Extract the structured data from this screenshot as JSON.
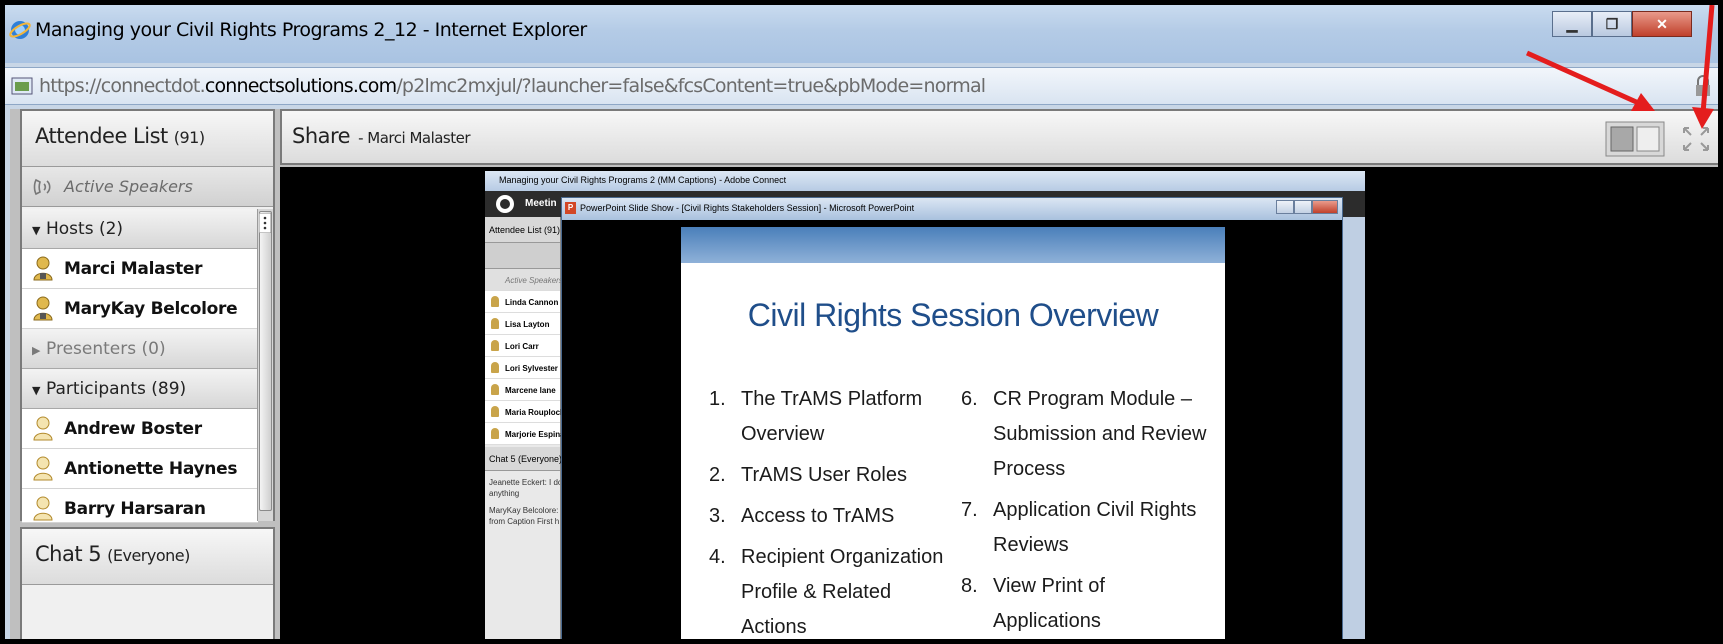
{
  "window": {
    "title": "Managing your Civil Rights Programs 2_12 - Internet Explorer",
    "url_prefix": "https://connectdot.",
    "url_domain": "connectsolutions.com",
    "url_rest": "/p2lmc2mxjul/?launcher=false&fcsContent=true&pbMode=normal"
  },
  "attendee_pod": {
    "title": "Attendee List",
    "count": "(91)",
    "active_speakers": "Active Speakers",
    "groups": {
      "hosts": "Hosts (2)",
      "presenters": "Presenters (0)",
      "participants": "Participants (89)"
    },
    "hosts": [
      "Marci Malaster",
      "MaryKay Belcolore"
    ],
    "participants": [
      "Andrew Boster",
      "Antionette Haynes",
      "Barry Harsaran"
    ]
  },
  "chat_pod": {
    "title": "Chat 5",
    "scope": "(Everyone)"
  },
  "share_pod": {
    "title": "Share",
    "presenter": "- Marci Malaster"
  },
  "nested_screen": {
    "window_title": "Managing your Civil Rights Programs 2 (MM Captions) - Adobe Connect",
    "toolbar_label": "Meetin",
    "attendee_header": "Attendee List (91)",
    "active_speakers": "Active Speakers",
    "names": [
      "Linda Cannon",
      "Lisa Layton",
      "Lori Carr",
      "Lori Sylvester",
      "Marcene lane",
      "Maria Rouploch",
      "Marjorie Espina"
    ],
    "chat_header": "Chat 5 (Everyone)",
    "chat_lines": [
      "Jeanette Eckert: I do",
      "anything",
      "MaryKay Belcolore:",
      "from Caption First h"
    ]
  },
  "powerpoint": {
    "window_title": "PowerPoint Slide Show - [Civil Rights Stakeholders Session] - Microsoft PowerPoint",
    "icon_letter": "P"
  },
  "slide": {
    "title": "Civil Rights Session Overview",
    "left_items": [
      {
        "num": "1.",
        "text": "The TrAMS Platform Overview"
      },
      {
        "num": "2.",
        "text": "TrAMS User Roles"
      },
      {
        "num": "3.",
        "text": "Access to TrAMS"
      },
      {
        "num": "4.",
        "text": "Recipient Organization Profile & Related Actions"
      }
    ],
    "right_items": [
      {
        "num": "6.",
        "text": "CR Program Module – Submission and Review Process"
      },
      {
        "num": "7.",
        "text": "Application Civil Rights Reviews"
      },
      {
        "num": "8.",
        "text": "View Print of Applications"
      }
    ]
  },
  "colors": {
    "arrow": "#e41d1d",
    "slide_title": "#1f4e8a",
    "host_icon": "#c9a44a"
  }
}
